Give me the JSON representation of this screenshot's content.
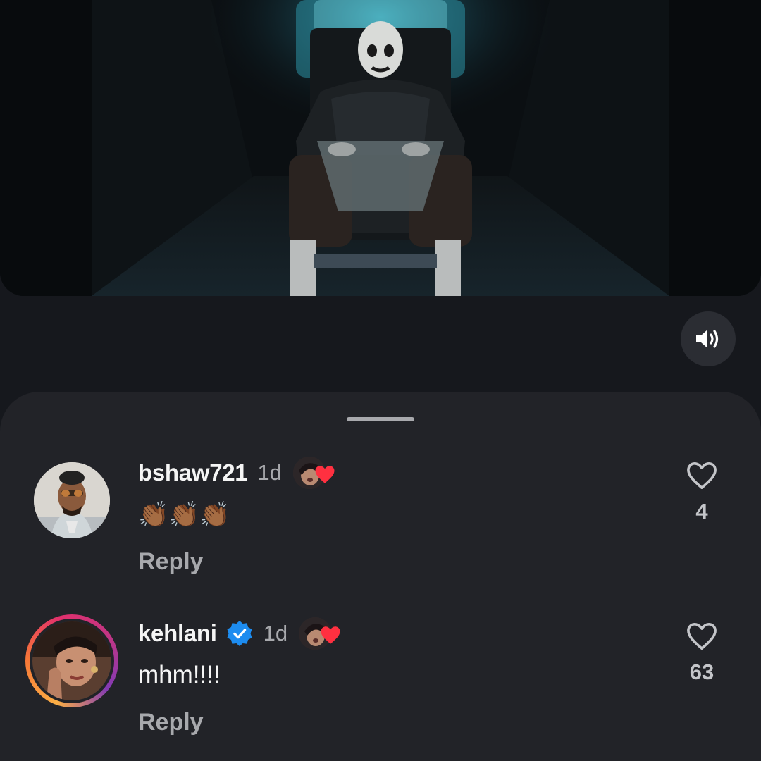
{
  "video": {
    "muted_state": "sound-on",
    "icon": "speaker-icon"
  },
  "sheet": {
    "handle_icon": "drag-handle"
  },
  "comments": [
    {
      "username": "bshaw721",
      "verified": false,
      "time": "1d",
      "text": "👏🏾👏🏾👏🏾",
      "reply_label": "Reply",
      "likes": "4",
      "creator_liked": true
    },
    {
      "username": "kehlani",
      "verified": true,
      "time": "1d",
      "text": "mhm!!!!",
      "reply_label": "Reply",
      "likes": "63",
      "creator_liked": true
    }
  ],
  "colors": {
    "background": "#16181d",
    "sheet": "#222328",
    "muted_text": "#a8a9ad",
    "verified_blue": "#1d8cf0",
    "heart_red": "#ff3040"
  }
}
